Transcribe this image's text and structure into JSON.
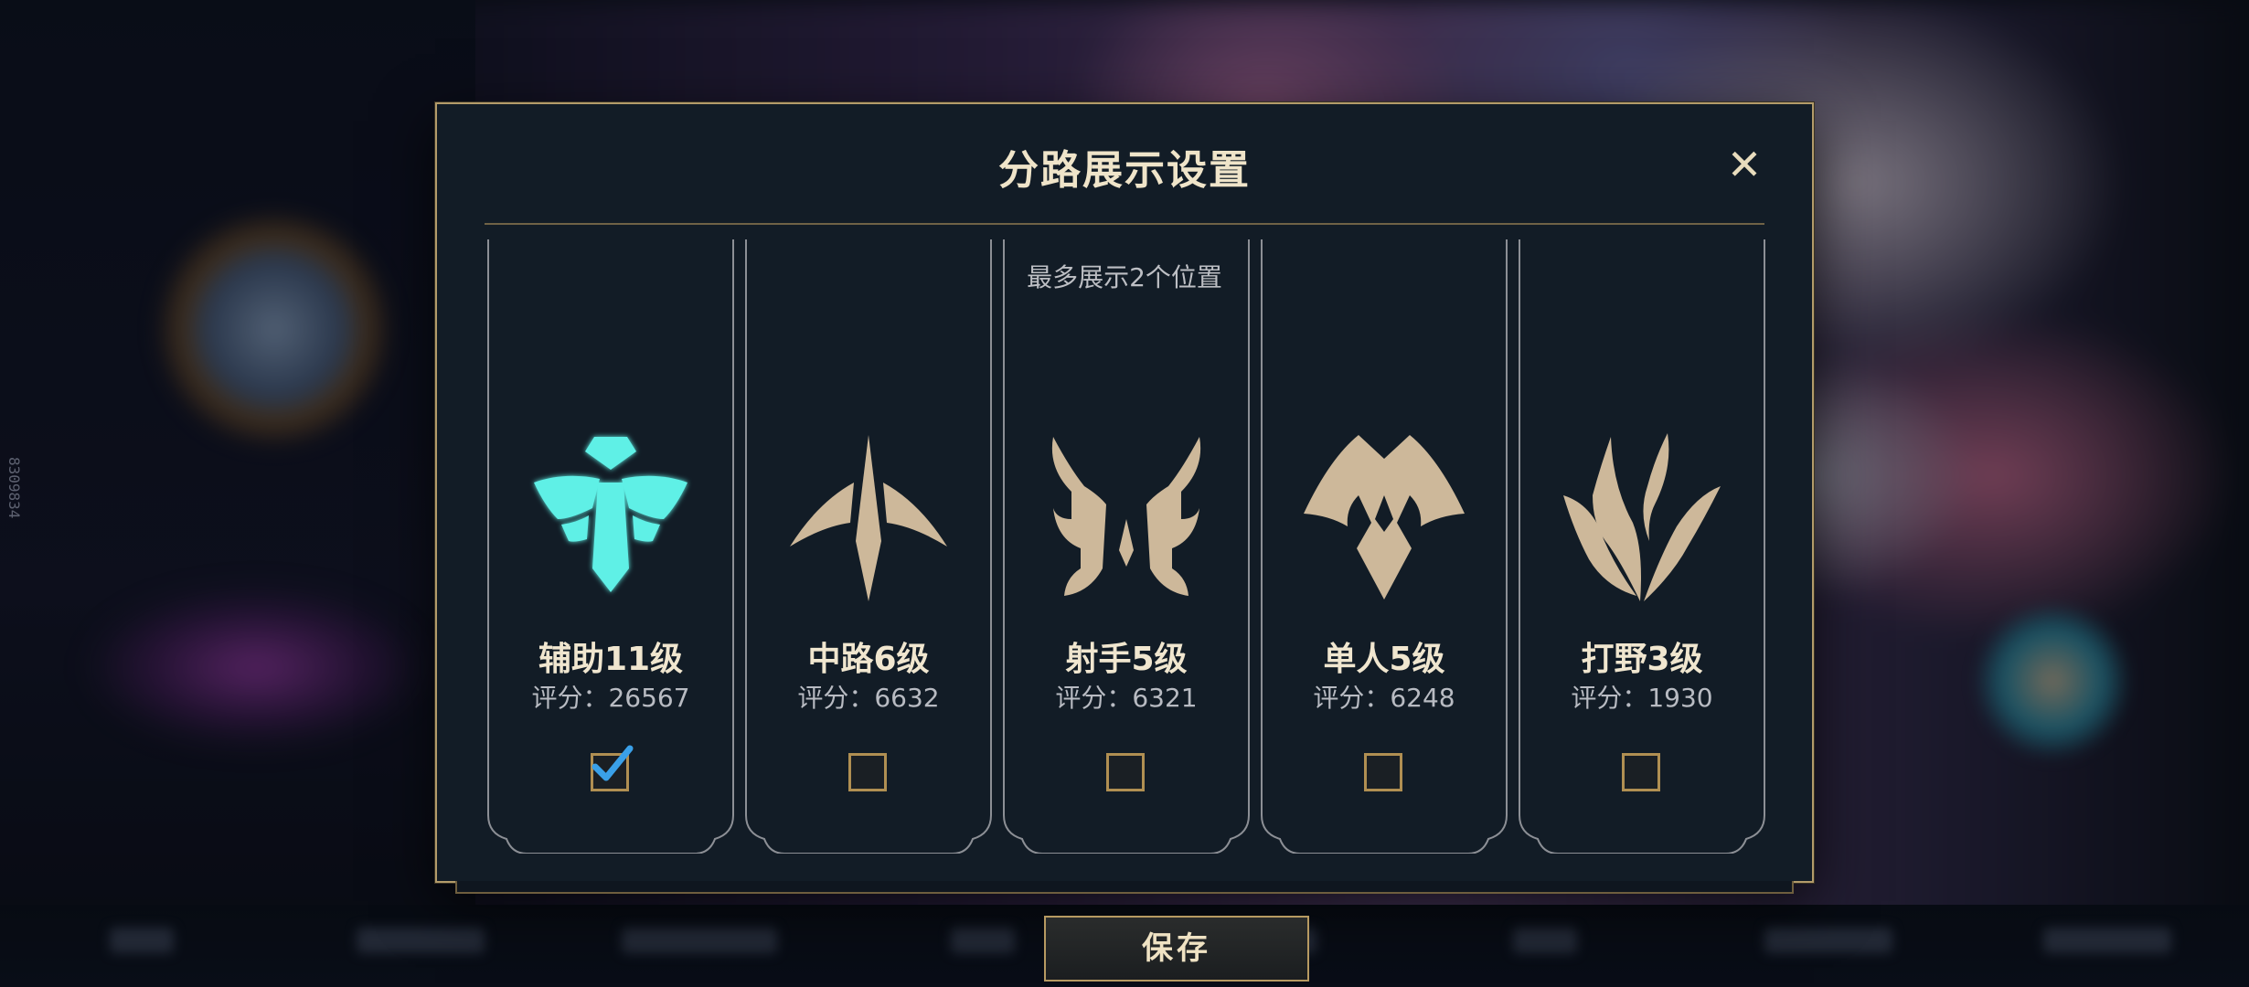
{
  "dialog": {
    "title": "分路展示设置",
    "hint": "最多展示2个位置",
    "close_glyph": "✕",
    "save_label": "保存"
  },
  "lanes": [
    {
      "name": "辅助11级",
      "score": "评分：26567",
      "checked": true,
      "icon": "support-lane-icon"
    },
    {
      "name": "中路6级",
      "score": "评分：6632",
      "checked": false,
      "icon": "mid-lane-icon"
    },
    {
      "name": "射手5级",
      "score": "评分：6321",
      "checked": false,
      "icon": "marksman-lane-icon"
    },
    {
      "name": "单人5级",
      "score": "评分：6248",
      "checked": false,
      "icon": "solo-lane-icon"
    },
    {
      "name": "打野3级",
      "score": "评分：1930",
      "checked": false,
      "icon": "jungle-lane-icon"
    }
  ],
  "background": {
    "side_code": "8309834"
  },
  "colors": {
    "accent_gold": "#b39b6a",
    "selected_cyan": "#5ff0e6",
    "icon_beige": "#cdb89a",
    "panel_bg": "#121c26",
    "check_blue": "#3aa0e8"
  }
}
